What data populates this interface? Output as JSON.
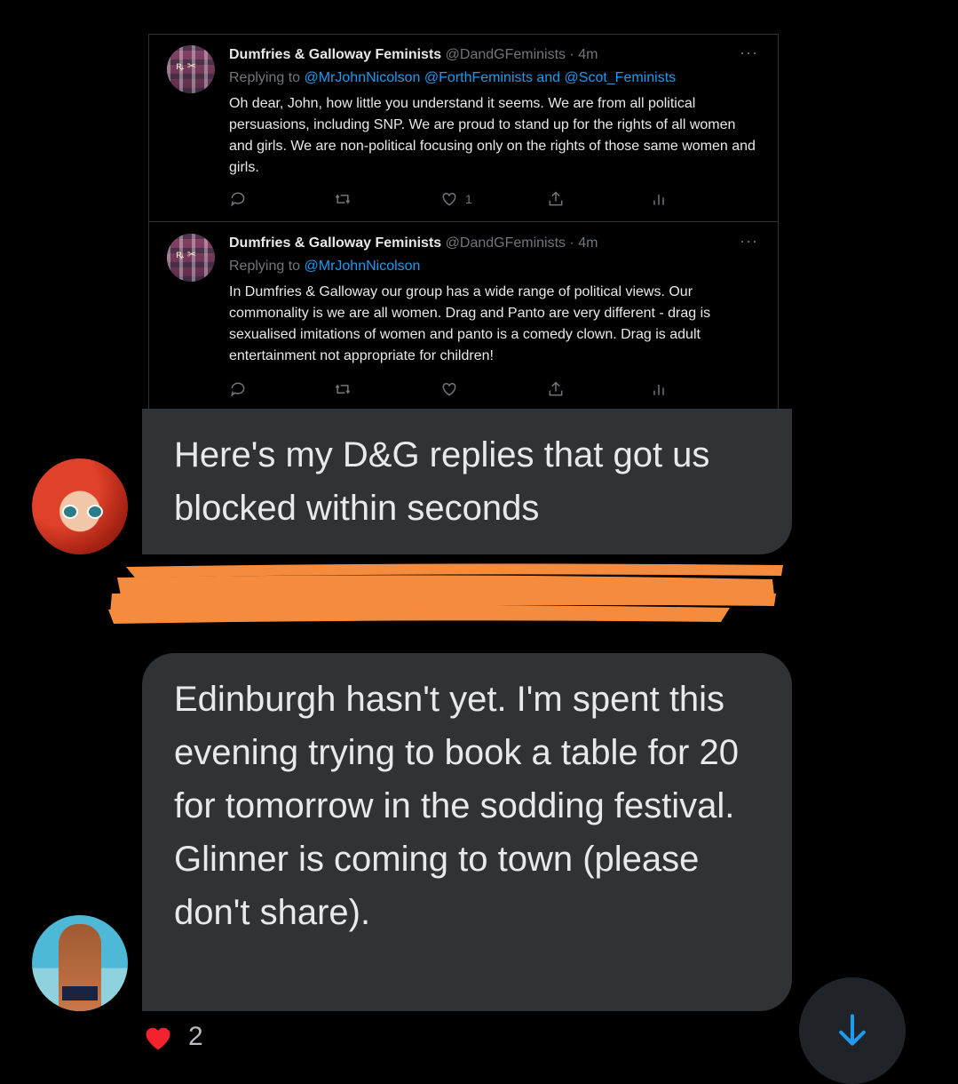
{
  "tweets": [
    {
      "author_name": "Dumfries & Galloway Feminists",
      "author_handle": "@DandGFeminists · 4m",
      "replying_prefix": "Replying to ",
      "replying_to": "@MrJohnNicolson @ForthFeminists and @Scot_Feminists",
      "body": "Oh dear, John, how little you understand it seems. We are from all political persuasions, including SNP. We are proud to stand up for the rights of all women and girls. We are non-political focusing only on the rights of those same women and girls.",
      "like_count": "1"
    },
    {
      "author_name": "Dumfries & Galloway Feminists",
      "author_handle": "@DandGFeminists · 4m",
      "replying_prefix": "Replying to ",
      "replying_to": "@MrJohnNicolson",
      "body": "In Dumfries & Galloway our group has a wide range of political views. Our commonality is we are all women.  Drag and Panto are very different - drag is sexualised imitations of women and panto is a comedy clown. Drag is adult entertainment not appropriate for children!",
      "like_count": ""
    }
  ],
  "messages": [
    {
      "text": "Here's my D&G replies that got us blocked within seconds"
    },
    {
      "text": "Edinburgh hasn't yet. I'm spent this evening trying to book a table for 20 for tomorrow in the sodding festival. Glinner is coming to town (please don't share)."
    }
  ],
  "reaction": {
    "icon": "heart-icon",
    "count": "2"
  },
  "colors": {
    "link": "#1d9bf0",
    "bubble": "#2f3336",
    "redaction": "#f58b3c",
    "heart": "#f4212e"
  }
}
